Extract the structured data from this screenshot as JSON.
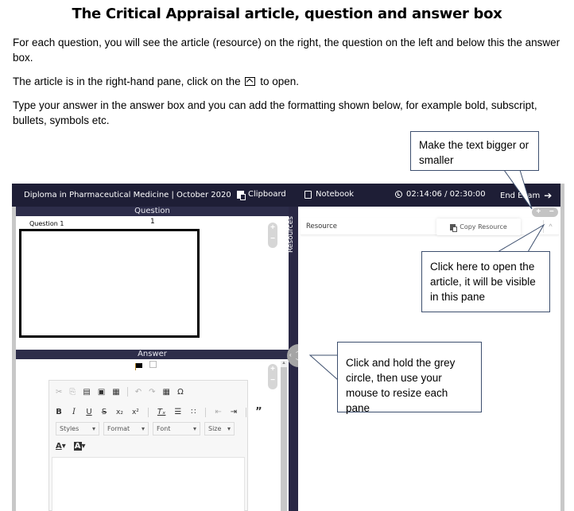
{
  "document": {
    "title": "The Critical Appraisal article, question and answer box",
    "paragraph1": "For each question, you will see the article (resource) on the right, the question on the left and below this the answer box.",
    "paragraph2_before": "The article is in the right-hand pane, click on the",
    "paragraph2_after": "to open.",
    "paragraph2_icon": "expand-pane-icon",
    "paragraph3": "Type your answer in the answer box and you can add the formatting shown below, for example bold, subscript, bullets, symbols etc."
  },
  "topbar": {
    "course": "Diploma in Pharmaceutical Medicine | October 2020",
    "clipboard": "Clipboard",
    "notebook": "Notebook",
    "timer": "02:14:06 / 02:30:00",
    "end_exam": "End Exam",
    "end_icon": "➔"
  },
  "question_pane": {
    "header": "Question",
    "label": "Question 1",
    "number": "1",
    "zoom_plus": "+",
    "zoom_minus": "−"
  },
  "answer_pane": {
    "header": "Answer",
    "zoom_plus": "+",
    "zoom_minus": "−"
  },
  "editor": {
    "row1": [
      "✂",
      "⎘",
      "▤",
      "▣",
      "▦",
      "↶",
      "↷",
      "▦",
      "Ω"
    ],
    "row2": [
      "B",
      "I",
      "U",
      "S",
      "x₂",
      "x²",
      "Tₓ",
      "☰",
      "∷",
      "⇤",
      "⇥",
      "”"
    ],
    "dropdowns": [
      "Styles",
      "Format",
      "Font",
      "Size"
    ],
    "text_color": "A",
    "bg_color": "A",
    "caret": "▾"
  },
  "resources": {
    "tab_label": "Resources",
    "resource_label": "Resource",
    "copy_resource": "Copy Resource",
    "expand_icon": "^",
    "font_plus": "+",
    "font_minus": "−"
  },
  "callouts": {
    "text_size": "Make the text bigger or smaller",
    "open_article": "Click here to open the article, it will be visible in this pane",
    "resize": "Click and hold the grey circle, then use your mouse to resize each pane"
  }
}
